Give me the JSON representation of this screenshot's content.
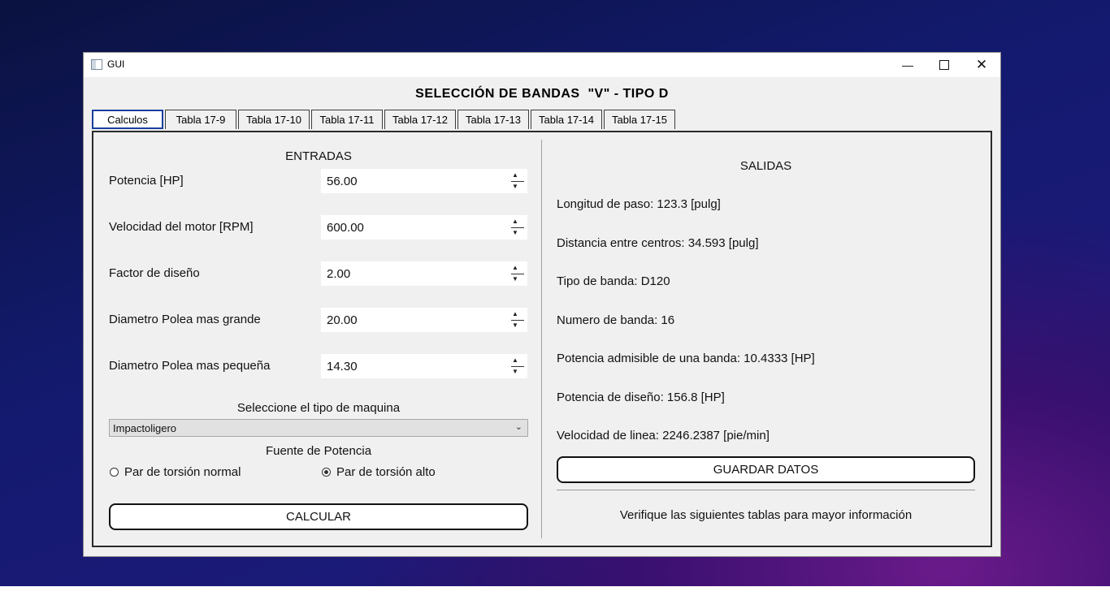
{
  "window": {
    "title": "GUI"
  },
  "heading": "SELECCIÓN DE BANDAS  \"V\" - TIPO D",
  "tabs": [
    "Calculos",
    "Tabla 17-9",
    "Tabla 17-10",
    "Tabla 17-11",
    "Tabla 17-12",
    "Tabla 17-13",
    "Tabla 17-14",
    "Tabla 17-15"
  ],
  "inputs": {
    "title": "ENTRADAS",
    "fields": [
      {
        "label": "Potencia [HP]",
        "value": "56.00"
      },
      {
        "label": "Velocidad del motor [RPM]",
        "value": "600.00"
      },
      {
        "label": "Factor de diseño",
        "value": "2.00"
      },
      {
        "label": "Diametro Polea mas grande",
        "value": "20.00"
      },
      {
        "label": "Diametro Polea mas pequeña",
        "value": "14.30"
      }
    ],
    "machine_label": "Seleccione el tipo de maquina",
    "machine_value": "Impactoligero",
    "power_source_label": "Fuente de Potencia",
    "radio_normal": "Par de torsión normal",
    "radio_high": "Par de torsión alto",
    "selected_radio": "Par de torsión alto",
    "calc_button": "CALCULAR"
  },
  "outputs": {
    "title": "SALIDAS",
    "lines": [
      "Longitud de paso: 123.3 [pulg]",
      "Distancia entre centros: 34.593 [pulg]",
      "Tipo de banda: D120",
      "Numero de banda: 16",
      "Potencia admisible de una banda: 10.4333 [HP]",
      "Potencia de diseño: 156.8 [HP]",
      "Velocidad de linea: 2246.2387 [pie/min]"
    ],
    "save_button": "GUARDAR DATOS",
    "note": "Verifique las siguientes tablas para mayor información"
  }
}
